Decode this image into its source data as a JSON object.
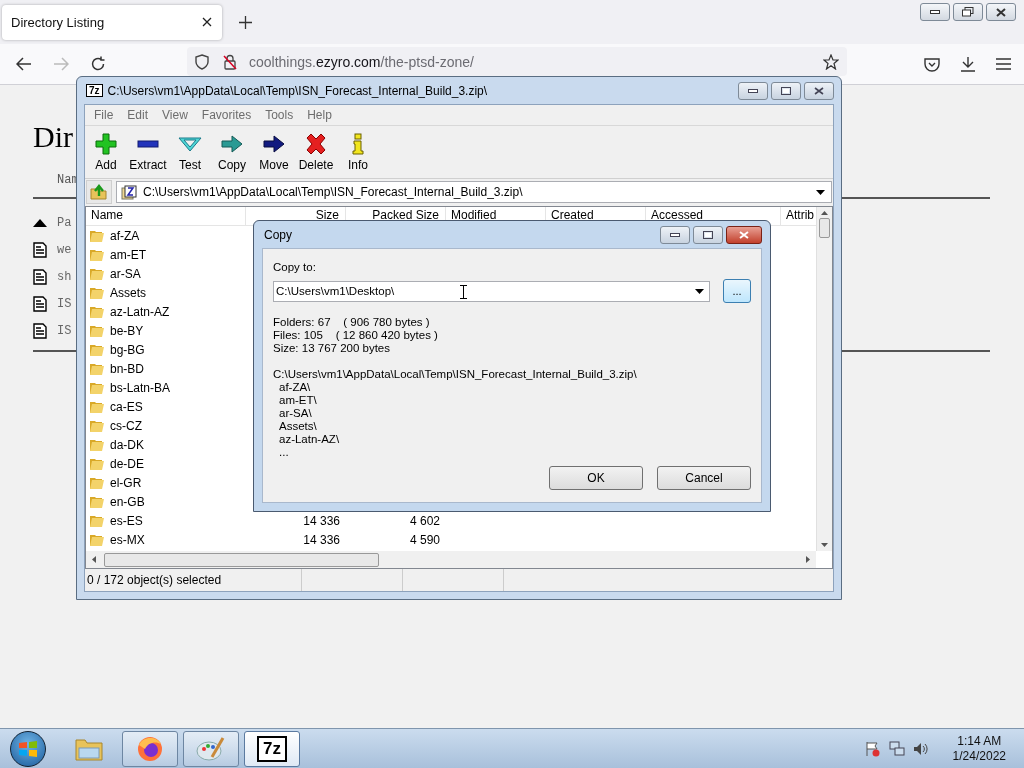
{
  "browser": {
    "tab_title": "Directory Listing",
    "url": {
      "prefix": "coolthings.",
      "domain": "ezyro.com",
      "path": "/the-ptsd-zone/"
    }
  },
  "page": {
    "heading": "Dir",
    "header": "Nam",
    "rows": [
      {
        "kind": "parent",
        "name": "Pa"
      },
      {
        "kind": "file",
        "name": "we"
      },
      {
        "kind": "file",
        "name": "sh"
      },
      {
        "kind": "file",
        "name": "IS"
      },
      {
        "kind": "file",
        "name": "IS"
      }
    ]
  },
  "archive_window": {
    "logo": "7z",
    "title": "C:\\Users\\vm1\\AppData\\Local\\Temp\\ISN_Forecast_Internal_Build_3.zip\\",
    "menu": [
      "File",
      "Edit",
      "View",
      "Favorites",
      "Tools",
      "Help"
    ],
    "toolbar": [
      {
        "kind": "add",
        "label": "Add"
      },
      {
        "kind": "extract",
        "label": "Extract"
      },
      {
        "kind": "test",
        "label": "Test"
      },
      {
        "kind": "copy",
        "label": "Copy"
      },
      {
        "kind": "move",
        "label": "Move"
      },
      {
        "kind": "delete",
        "label": "Delete"
      },
      {
        "kind": "info",
        "label": "Info"
      }
    ],
    "address": "C:\\Users\\vm1\\AppData\\Local\\Temp\\ISN_Forecast_Internal_Build_3.zip\\",
    "columns": [
      "Name",
      "Size",
      "Packed Size",
      "Modified",
      "Created",
      "Accessed",
      "Attrib"
    ],
    "rows": [
      {
        "name": "af-ZA"
      },
      {
        "name": "am-ET"
      },
      {
        "name": "ar-SA"
      },
      {
        "name": "Assets"
      },
      {
        "name": "az-Latn-AZ"
      },
      {
        "name": "be-BY"
      },
      {
        "name": "bg-BG"
      },
      {
        "name": "bn-BD"
      },
      {
        "name": "bs-Latn-BA"
      },
      {
        "name": "ca-ES"
      },
      {
        "name": "cs-CZ"
      },
      {
        "name": "da-DK"
      },
      {
        "name": "de-DE"
      },
      {
        "name": "el-GR"
      },
      {
        "name": "en-GB"
      },
      {
        "name": "es-ES",
        "size": "14 336",
        "packed_size": "4 602"
      },
      {
        "name": "es-MX",
        "size": "14 336",
        "packed_size": "4 590"
      }
    ],
    "status": "0 / 172 object(s) selected"
  },
  "copy_dialog": {
    "title": "Copy",
    "label": "Copy to:",
    "value": "C:\\Users\\vm1\\Desktop\\",
    "browse": "...",
    "summary": [
      "Folders: 67    ( 906 780 bytes )",
      "Files: 105    ( 12 860 420 bytes )",
      "Size: 13 767 200 bytes"
    ],
    "listing": {
      "path": "C:\\Users\\vm1\\AppData\\Local\\Temp\\ISN_Forecast_Internal_Build_3.zip\\",
      "items": [
        "af-ZA\\",
        "am-ET\\",
        "ar-SA\\",
        "Assets\\",
        "az-Latn-AZ\\",
        "..."
      ]
    },
    "buttons": [
      "OK",
      "Cancel"
    ]
  },
  "taskbar": {
    "apps": [
      {
        "kind": "explorer",
        "running": false,
        "selected": false
      },
      {
        "kind": "firefox",
        "running": true,
        "selected": false
      },
      {
        "kind": "paint",
        "running": true,
        "selected": false
      },
      {
        "kind": "archiver",
        "label": "7z",
        "running": true,
        "selected": true
      }
    ],
    "time": "1:14 AM",
    "date": "1/24/2022"
  }
}
